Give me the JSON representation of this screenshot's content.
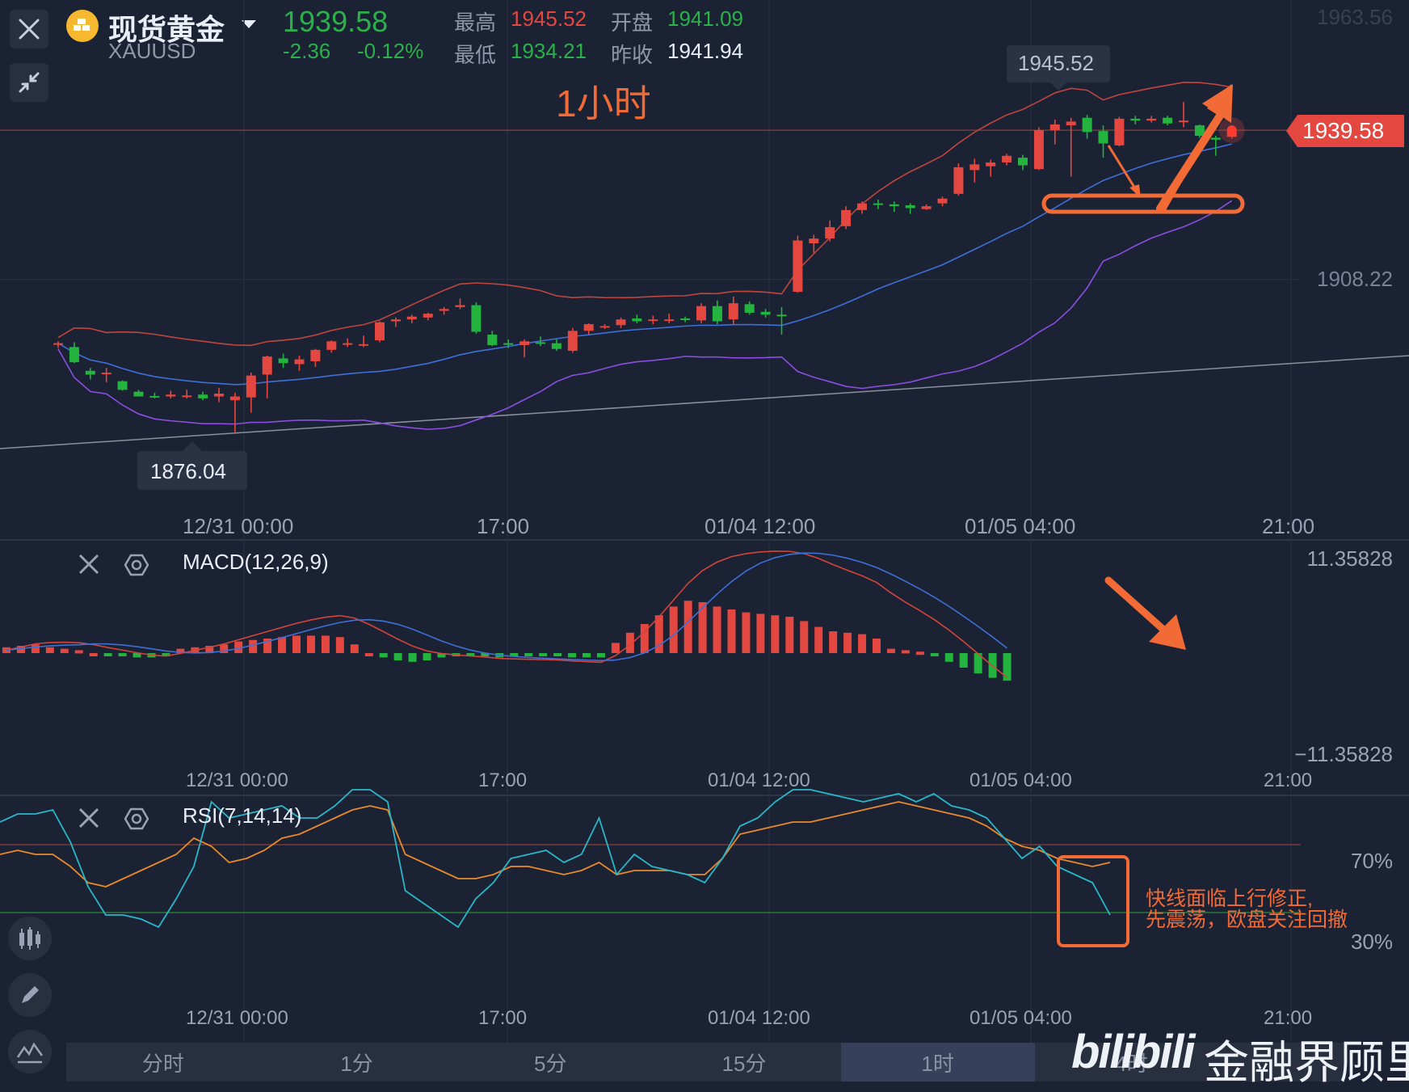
{
  "header": {
    "name": "现货黄金",
    "symbol": "XAUUSD",
    "price": "1939.58",
    "change": "-2.36",
    "change_pct": "-0.12%",
    "high_label": "最高",
    "high": "1945.52",
    "low_label": "最低",
    "low": "1934.21",
    "open_label": "开盘",
    "open": "1941.09",
    "prev_label": "昨收",
    "prev": "1941.94",
    "timeframe_note": "1小时"
  },
  "main_chart": {
    "price_axis": [
      "1963.56",
      "1908.22"
    ],
    "current_price_tag": "1939.58",
    "max_callout": "1945.52",
    "min_callout": "1876.04",
    "time_axis": [
      "12/31 00:00",
      "17:00",
      "01/04 12:00",
      "01/05 04:00",
      "21:00"
    ]
  },
  "macd_panel": {
    "title": "MACD(12,26,9)",
    "axis_top": "11.35828",
    "axis_bottom": "−11.35828",
    "time_axis": [
      "12/31 00:00",
      "17:00",
      "01/04 12:00",
      "01/05 04:00",
      "21:00"
    ]
  },
  "rsi_panel": {
    "title": "RSI(7,14,14)",
    "level_70": "70%",
    "level_30": "30%",
    "annotation_line1": "快线面临上行修正,",
    "annotation_line2": "先震荡，欧盘关注回撤",
    "time_axis": [
      "12/31 00:00",
      "17:00",
      "01/04 12:00",
      "01/05 04:00",
      "21:00"
    ]
  },
  "tabs": [
    "分时",
    "1分",
    "5分",
    "15分",
    "1时",
    "4时"
  ],
  "active_tab": "1时",
  "watermark": {
    "brand": "bilibili",
    "text": "金融界顾里"
  },
  "colors": {
    "background": "#1a2233",
    "up": "#e4473f",
    "down": "#25b340",
    "accent": "#f26a36",
    "ma_mid": "#3f6fd8",
    "boll_low": "#8a4fe0",
    "rsi_fast": "#2ab7c9",
    "rsi_slow": "#e88a2c"
  },
  "chart_data": [
    {
      "type": "candlestick",
      "title": "现货黄金 XAUUSD 1小时",
      "x": [
        "12/31 00:00",
        "17:00",
        "01/04 12:00",
        "01/05 04:00",
        "21:00"
      ],
      "ylim": [
        1876.04,
        1963.56
      ],
      "candles": [
        {
          "o": 1894.5,
          "h": 1895.2,
          "l": 1893.8,
          "c": 1894.8
        },
        {
          "o": 1894.0,
          "h": 1895.0,
          "l": 1890.6,
          "c": 1890.8
        },
        {
          "o": 1889.0,
          "h": 1889.6,
          "l": 1887.2,
          "c": 1888.2
        },
        {
          "o": 1888.4,
          "h": 1889.6,
          "l": 1886.6,
          "c": 1888.6
        },
        {
          "o": 1886.8,
          "h": 1887.0,
          "l": 1884.8,
          "c": 1885.0
        },
        {
          "o": 1884.6,
          "h": 1885.0,
          "l": 1883.6,
          "c": 1883.6
        },
        {
          "o": 1883.7,
          "h": 1884.4,
          "l": 1883.2,
          "c": 1883.4
        },
        {
          "o": 1883.6,
          "h": 1884.8,
          "l": 1883.2,
          "c": 1884.0
        },
        {
          "o": 1883.8,
          "h": 1885.0,
          "l": 1883.2,
          "c": 1883.8
        },
        {
          "o": 1884.0,
          "h": 1884.6,
          "l": 1882.8,
          "c": 1883.2
        },
        {
          "o": 1883.6,
          "h": 1885.4,
          "l": 1882.4,
          "c": 1884.2
        },
        {
          "o": 1882.8,
          "h": 1884.4,
          "l": 1876.0,
          "c": 1883.6
        },
        {
          "o": 1883.4,
          "h": 1888.6,
          "l": 1880.2,
          "c": 1888.0
        },
        {
          "o": 1888.2,
          "h": 1892.2,
          "l": 1883.2,
          "c": 1892.0
        },
        {
          "o": 1891.6,
          "h": 1892.6,
          "l": 1889.6,
          "c": 1890.6
        },
        {
          "o": 1890.4,
          "h": 1892.2,
          "l": 1889.0,
          "c": 1891.4
        },
        {
          "o": 1891.0,
          "h": 1893.6,
          "l": 1889.8,
          "c": 1893.4
        },
        {
          "o": 1893.4,
          "h": 1895.4,
          "l": 1892.8,
          "c": 1895.2
        },
        {
          "o": 1894.8,
          "h": 1895.8,
          "l": 1894.0,
          "c": 1894.8
        },
        {
          "o": 1894.4,
          "h": 1896.4,
          "l": 1894.0,
          "c": 1894.6
        },
        {
          "o": 1895.4,
          "h": 1899.4,
          "l": 1895.0,
          "c": 1899.2
        },
        {
          "o": 1899.4,
          "h": 1900.2,
          "l": 1898.2,
          "c": 1899.8
        },
        {
          "o": 1899.8,
          "h": 1900.8,
          "l": 1899.0,
          "c": 1900.4
        },
        {
          "o": 1900.2,
          "h": 1901.2,
          "l": 1899.6,
          "c": 1901.0
        },
        {
          "o": 1901.6,
          "h": 1902.4,
          "l": 1900.8,
          "c": 1902.0
        },
        {
          "o": 1902.4,
          "h": 1904.2,
          "l": 1902.0,
          "c": 1902.8
        },
        {
          "o": 1902.8,
          "h": 1903.4,
          "l": 1896.8,
          "c": 1897.2
        },
        {
          "o": 1896.6,
          "h": 1897.4,
          "l": 1894.2,
          "c": 1894.4
        },
        {
          "o": 1894.8,
          "h": 1895.6,
          "l": 1893.8,
          "c": 1894.6
        },
        {
          "o": 1894.4,
          "h": 1895.6,
          "l": 1891.8,
          "c": 1895.2
        },
        {
          "o": 1895.0,
          "h": 1896.2,
          "l": 1894.2,
          "c": 1894.8
        },
        {
          "o": 1894.8,
          "h": 1895.6,
          "l": 1893.2,
          "c": 1893.6
        },
        {
          "o": 1893.2,
          "h": 1898.0,
          "l": 1892.8,
          "c": 1897.4
        },
        {
          "o": 1897.4,
          "h": 1899.0,
          "l": 1896.6,
          "c": 1898.8
        },
        {
          "o": 1898.2,
          "h": 1898.8,
          "l": 1897.8,
          "c": 1898.4
        },
        {
          "o": 1898.6,
          "h": 1900.2,
          "l": 1898.0,
          "c": 1899.8
        },
        {
          "o": 1900.0,
          "h": 1900.8,
          "l": 1899.0,
          "c": 1899.4
        },
        {
          "o": 1899.6,
          "h": 1900.6,
          "l": 1898.8,
          "c": 1899.8
        },
        {
          "o": 1899.6,
          "h": 1901.0,
          "l": 1899.0,
          "c": 1899.8
        },
        {
          "o": 1900.0,
          "h": 1900.4,
          "l": 1899.2,
          "c": 1899.8
        },
        {
          "o": 1899.6,
          "h": 1903.2,
          "l": 1899.0,
          "c": 1902.6
        },
        {
          "o": 1902.6,
          "h": 1903.8,
          "l": 1898.8,
          "c": 1899.4
        },
        {
          "o": 1899.8,
          "h": 1904.6,
          "l": 1898.8,
          "c": 1903.2
        },
        {
          "o": 1903.0,
          "h": 1903.6,
          "l": 1900.8,
          "c": 1901.2
        },
        {
          "o": 1901.4,
          "h": 1902.0,
          "l": 1900.2,
          "c": 1900.8
        },
        {
          "o": 1900.8,
          "h": 1902.4,
          "l": 1896.6,
          "c": 1900.6
        },
        {
          "o": 1905.6,
          "h": 1917.4,
          "l": 1905.4,
          "c": 1916.4
        },
        {
          "o": 1915.8,
          "h": 1917.6,
          "l": 1913.8,
          "c": 1916.8
        },
        {
          "o": 1916.8,
          "h": 1920.6,
          "l": 1916.2,
          "c": 1919.2
        },
        {
          "o": 1919.4,
          "h": 1923.6,
          "l": 1918.8,
          "c": 1922.8
        },
        {
          "o": 1922.8,
          "h": 1924.6,
          "l": 1922.0,
          "c": 1924.2
        },
        {
          "o": 1924.2,
          "h": 1925.0,
          "l": 1923.0,
          "c": 1924.0
        },
        {
          "o": 1924.0,
          "h": 1924.6,
          "l": 1922.4,
          "c": 1923.6
        },
        {
          "o": 1923.8,
          "h": 1924.2,
          "l": 1922.0,
          "c": 1923.2
        },
        {
          "o": 1923.0,
          "h": 1924.0,
          "l": 1922.8,
          "c": 1923.6
        },
        {
          "o": 1924.2,
          "h": 1925.6,
          "l": 1923.6,
          "c": 1925.2
        },
        {
          "o": 1926.2,
          "h": 1932.6,
          "l": 1925.8,
          "c": 1931.8
        },
        {
          "o": 1931.2,
          "h": 1933.6,
          "l": 1928.6,
          "c": 1932.4
        },
        {
          "o": 1932.0,
          "h": 1933.4,
          "l": 1929.8,
          "c": 1932.8
        },
        {
          "o": 1932.8,
          "h": 1934.6,
          "l": 1932.2,
          "c": 1934.2
        },
        {
          "o": 1933.8,
          "h": 1934.4,
          "l": 1931.2,
          "c": 1932.2
        },
        {
          "o": 1931.4,
          "h": 1940.2,
          "l": 1931.2,
          "c": 1939.6
        },
        {
          "o": 1939.6,
          "h": 1941.8,
          "l": 1936.6,
          "c": 1940.8
        },
        {
          "o": 1940.6,
          "h": 1942.2,
          "l": 1929.8,
          "c": 1941.4
        },
        {
          "o": 1942.2,
          "h": 1942.8,
          "l": 1937.8,
          "c": 1939.2
        },
        {
          "o": 1939.4,
          "h": 1940.6,
          "l": 1933.8,
          "c": 1936.8
        },
        {
          "o": 1936.4,
          "h": 1942.4,
          "l": 1936.2,
          "c": 1942.0
        },
        {
          "o": 1942.0,
          "h": 1942.6,
          "l": 1940.8,
          "c": 1941.6
        },
        {
          "o": 1941.6,
          "h": 1942.6,
          "l": 1941.2,
          "c": 1942.0
        },
        {
          "o": 1942.2,
          "h": 1942.6,
          "l": 1940.6,
          "c": 1941.0
        },
        {
          "o": 1941.4,
          "h": 1945.52,
          "l": 1940.2,
          "c": 1941.6
        },
        {
          "o": 1940.6,
          "h": 1940.8,
          "l": 1938.0,
          "c": 1938.4
        },
        {
          "o": 1938.0,
          "h": 1938.4,
          "l": 1934.21,
          "c": 1937.6
        },
        {
          "o": 1938.2,
          "h": 1939.8,
          "l": 1937.8,
          "c": 1939.58
        }
      ]
    },
    {
      "type": "bar",
      "title": "MACD(12,26,9)",
      "ylim": [
        -11.35828,
        11.35828
      ],
      "values": [
        0.4,
        0.5,
        0.6,
        0.4,
        0.3,
        0.2,
        0,
        -0.2,
        -0.2,
        -0.3,
        -0.3,
        -0.2,
        0.3,
        0.4,
        0.5,
        0.6,
        0.8,
        0.9,
        1.0,
        1.1,
        1.2,
        1.2,
        1.2,
        1.1,
        0.6,
        0,
        -0.3,
        -0.5,
        -0.6,
        -0.5,
        -0.3,
        -0.2,
        -0.2,
        -0.2,
        -0.3,
        -0.2,
        -0.2,
        -0.2,
        -0.2,
        -0.3,
        -0.3,
        -0.3,
        0.7,
        1.4,
        2.0,
        2.6,
        3.2,
        3.6,
        3.5,
        3.2,
        3.0,
        2.8,
        2.7,
        2.6,
        2.5,
        2.2,
        1.8,
        1.5,
        1.4,
        1.3,
        1.0,
        0.3,
        0.2,
        0.1,
        -0.2,
        -0.6,
        -1.0,
        -1.4,
        -1.7,
        -1.9
      ]
    },
    {
      "type": "line",
      "title": "RSI(7,14,14)",
      "ylim": [
        0,
        100
      ],
      "series": [
        {
          "values": [
            78,
            82,
            82,
            84,
            68,
            46,
            32,
            32,
            30,
            26,
            40,
            56,
            88,
            80,
            82,
            84,
            86,
            80,
            80,
            86,
            94,
            94,
            88,
            44,
            38,
            32,
            26,
            40,
            48,
            60,
            62,
            64,
            58,
            62,
            80,
            52,
            62,
            56,
            54,
            52,
            48,
            60,
            76,
            80,
            88,
            94,
            94,
            92,
            90,
            88,
            90,
            92,
            88,
            92,
            86,
            84,
            80,
            70,
            60,
            66,
            56,
            52,
            48,
            32
          ]
        },
        {
          "values": [
            62,
            64,
            62,
            62,
            56,
            48,
            46,
            50,
            54,
            58,
            62,
            70,
            66,
            58,
            60,
            64,
            70,
            72,
            76,
            80,
            84,
            86,
            84,
            62,
            58,
            54,
            50,
            50,
            52,
            56,
            56,
            54,
            52,
            54,
            58,
            52,
            54,
            54,
            54,
            52,
            52,
            60,
            72,
            74,
            76,
            78,
            78,
            80,
            82,
            84,
            86,
            88,
            86,
            84,
            82,
            80,
            76,
            70,
            66,
            64,
            60,
            58,
            56,
            58
          ]
        }
      ],
      "levels": [
        70,
        30
      ]
    }
  ]
}
